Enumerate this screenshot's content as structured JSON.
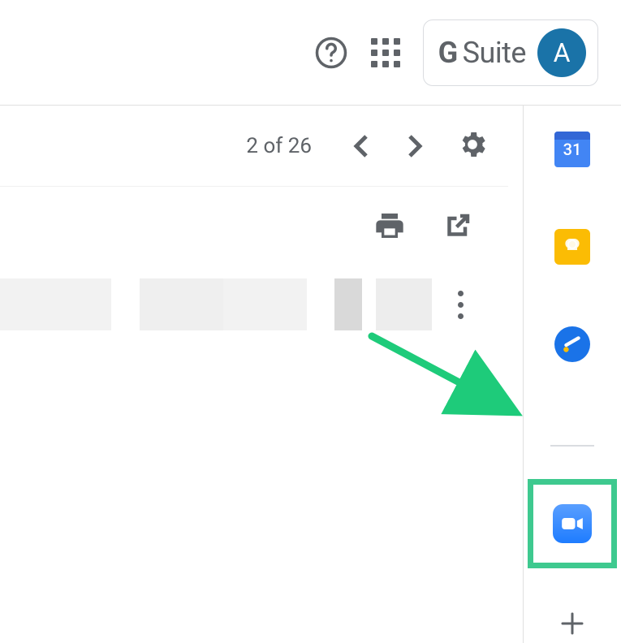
{
  "header": {
    "suite_label": "Suite",
    "suite_g": "G",
    "avatar_initial": "A"
  },
  "toolbar": {
    "pagination": "2 of 26"
  },
  "sidepanel": {
    "calendar_day": "31"
  }
}
